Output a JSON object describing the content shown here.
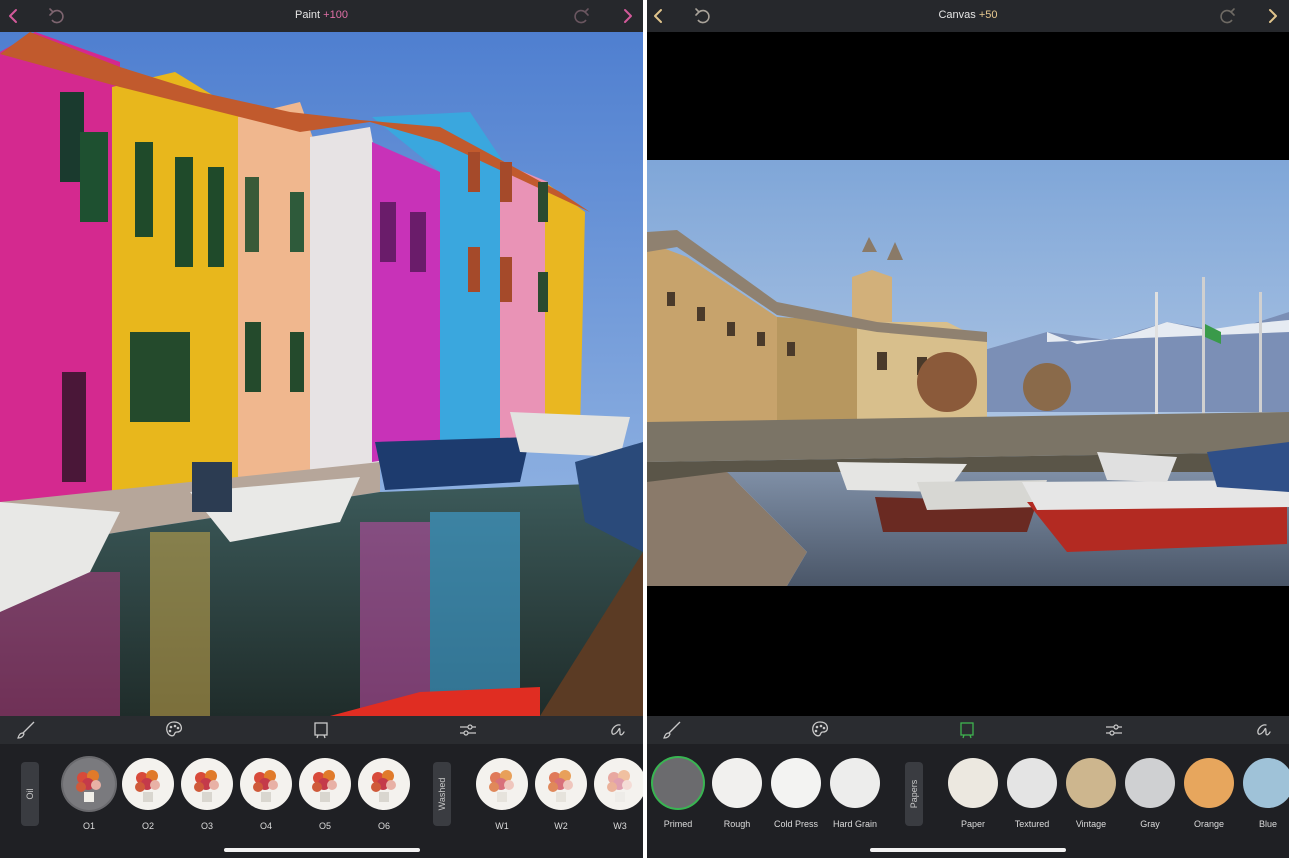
{
  "left": {
    "title": "Paint",
    "title_amount": "+100",
    "tray_groups": [
      "Oil",
      "Washed"
    ],
    "items": [
      {
        "label": "O1",
        "selected": true
      },
      {
        "label": "O2"
      },
      {
        "label": "O3"
      },
      {
        "label": "O4"
      },
      {
        "label": "O5"
      },
      {
        "label": "O6"
      },
      {
        "label": "W1"
      },
      {
        "label": "W2"
      },
      {
        "label": "W3"
      }
    ],
    "tools": [
      "brush-icon",
      "palette-icon",
      "canvas-icon",
      "adjust-icon",
      "signature-icon"
    ],
    "accent": "#e06fa6"
  },
  "right": {
    "title": "Canvas",
    "title_amount": "+50",
    "tray_groups": [
      "Papers"
    ],
    "canvases": [
      {
        "label": "Primed",
        "color": "#6b6b6e",
        "selected": true
      },
      {
        "label": "Rough",
        "color": "#f1f0ee"
      },
      {
        "label": "Cold Press",
        "color": "#f3f3f2"
      },
      {
        "label": "Hard Grain",
        "color": "#ededec"
      }
    ],
    "papers": [
      {
        "label": "Paper",
        "color": "#ece8e0"
      },
      {
        "label": "Textured",
        "color": "#e4e4e4"
      },
      {
        "label": "Vintage",
        "color": "#cdb68e"
      },
      {
        "label": "Gray",
        "color": "#cfd0d2"
      },
      {
        "label": "Orange",
        "color": "#e7a65d"
      },
      {
        "label": "Blue",
        "color": "#9fc2d8"
      }
    ],
    "tools": [
      "brush-icon",
      "palette-icon",
      "canvas-icon",
      "adjust-icon",
      "signature-icon"
    ],
    "accent": "#e8c990",
    "active_tool_color": "#3fb34f"
  }
}
